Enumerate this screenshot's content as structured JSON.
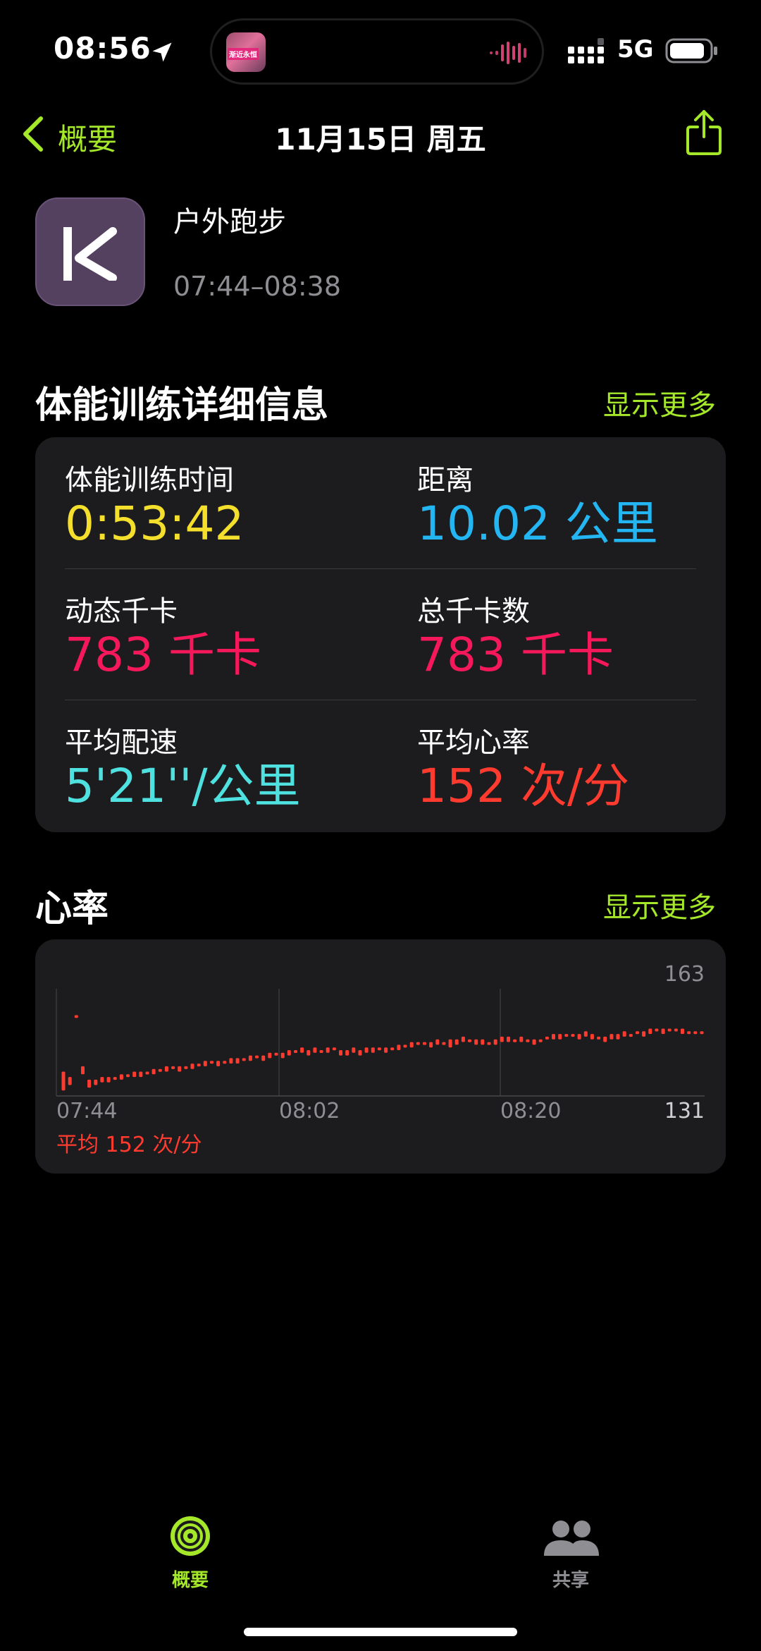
{
  "status_bar": {
    "time": "08:56",
    "network": "5G",
    "island_art_text": "渐近永恒",
    "icons": [
      "location-arrow-icon",
      "audio-wave-icon",
      "signal-bars-icon",
      "battery-icon"
    ]
  },
  "nav": {
    "back_label": "概要",
    "title": "11月15日 周五",
    "share_icon": "share-icon"
  },
  "workout": {
    "app_icon": "keep-app-icon",
    "name": "户外跑步",
    "time_range": "07:44–08:38"
  },
  "details": {
    "title": "体能训练详细信息",
    "show_more": "显示更多",
    "metrics": [
      {
        "label": "体能训练时间",
        "value": "0:53:42",
        "color": "#f4e02c"
      },
      {
        "label": "距离",
        "value": "10.02 公里",
        "color": "#23b6f2"
      },
      {
        "label": "动态千卡",
        "value": "783 千卡",
        "color": "#f5185b"
      },
      {
        "label": "总千卡数",
        "value": "783 千卡",
        "color": "#f5185b"
      },
      {
        "label": "平均配速",
        "value": "5'21''/公里",
        "color": "#4fe0e0"
      },
      {
        "label": "平均心率",
        "value": "152 次/分",
        "color": "#ff3b2f"
      }
    ]
  },
  "heart_rate": {
    "title": "心率",
    "show_more": "显示更多",
    "max_label": "163",
    "min_label": "131",
    "x_ticks": [
      "07:44",
      "08:02",
      "08:20"
    ],
    "average": "平均 152 次/分",
    "color": "#ff3b2f"
  },
  "chart_data": {
    "type": "bar",
    "title": "心率",
    "ylim": [
      131,
      163
    ],
    "x_ticks": [
      "07:44",
      "08:02",
      "08:20"
    ],
    "grid": true,
    "series": [
      {
        "values": [
          [
            132,
            139
          ],
          [
            134,
            137
          ],
          [
            159,
            160
          ],
          [
            138,
            141
          ],
          [
            133,
            136
          ],
          [
            134,
            136
          ],
          [
            135,
            137
          ],
          [
            135,
            137
          ],
          [
            136,
            137
          ],
          [
            136,
            138
          ],
          [
            137,
            138
          ],
          [
            137,
            139
          ],
          [
            137,
            139
          ],
          [
            138,
            139
          ],
          [
            138,
            140
          ],
          [
            139,
            140
          ],
          [
            139,
            141
          ],
          [
            140,
            141
          ],
          [
            139,
            141
          ],
          [
            140,
            141
          ],
          [
            140,
            142
          ],
          [
            141,
            142
          ],
          [
            141,
            143
          ],
          [
            142,
            143
          ],
          [
            141,
            143
          ],
          [
            142,
            143
          ],
          [
            142,
            144
          ],
          [
            142,
            144
          ],
          [
            143,
            144
          ],
          [
            143,
            145
          ],
          [
            144,
            145
          ],
          [
            143,
            145
          ],
          [
            144,
            146
          ],
          [
            145,
            146
          ],
          [
            144,
            146
          ],
          [
            145,
            147
          ],
          [
            146,
            147
          ],
          [
            146,
            148
          ],
          [
            145,
            147
          ],
          [
            146,
            148
          ],
          [
            146,
            147
          ],
          [
            146,
            148
          ],
          [
            147,
            148
          ],
          [
            145,
            147
          ],
          [
            145,
            147
          ],
          [
            146,
            148
          ],
          [
            145,
            147
          ],
          [
            146,
            148
          ],
          [
            146,
            148
          ],
          [
            147,
            148
          ],
          [
            146,
            148
          ],
          [
            147,
            148
          ],
          [
            147,
            149
          ],
          [
            148,
            149
          ],
          [
            148,
            150
          ],
          [
            149,
            150
          ],
          [
            149,
            150
          ],
          [
            148,
            150
          ],
          [
            149,
            151
          ],
          [
            149,
            150
          ],
          [
            148,
            151
          ],
          [
            149,
            151
          ],
          [
            150,
            152
          ],
          [
            150,
            151
          ],
          [
            149,
            151
          ],
          [
            149,
            151
          ],
          [
            149,
            150
          ],
          [
            149,
            151
          ],
          [
            150,
            152
          ],
          [
            150,
            152
          ],
          [
            150,
            151
          ],
          [
            150,
            152
          ],
          [
            150,
            151
          ],
          [
            149,
            151
          ],
          [
            150,
            151
          ],
          [
            151,
            152
          ],
          [
            151,
            153
          ],
          [
            151,
            153
          ],
          [
            152,
            153
          ],
          [
            152,
            153
          ],
          [
            151,
            153
          ],
          [
            152,
            154
          ],
          [
            151,
            153
          ],
          [
            151,
            152
          ],
          [
            150,
            152
          ],
          [
            151,
            153
          ],
          [
            151,
            153
          ],
          [
            152,
            154
          ],
          [
            152,
            153
          ],
          [
            153,
            154
          ],
          [
            152,
            154
          ],
          [
            153,
            155
          ],
          [
            154,
            155
          ],
          [
            153,
            155
          ],
          [
            154,
            155
          ],
          [
            154,
            155
          ],
          [
            153,
            155
          ],
          [
            153,
            154
          ],
          [
            153,
            154
          ],
          [
            153,
            154
          ]
        ]
      }
    ]
  },
  "tab_bar": {
    "tabs": [
      {
        "label": "概要",
        "icon": "activity-rings-icon",
        "active": true,
        "color": "#a5e82a"
      },
      {
        "label": "共享",
        "icon": "people-icon",
        "active": false,
        "color": "#8e8e93"
      }
    ]
  }
}
